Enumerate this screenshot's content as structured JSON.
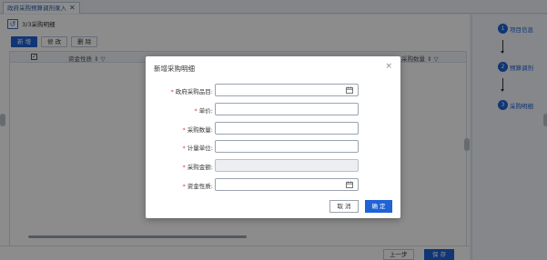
{
  "tabstrip": {
    "tab_label": "政府采购预算调剂录入",
    "tab_close": "✕"
  },
  "breadcrumb": {
    "back_icon": "↺",
    "text": "3/3采购明细"
  },
  "toolbar": {
    "add_label": "新 增",
    "edit_label": "修 改",
    "delete_label": "删 除"
  },
  "grid": {
    "columns": [
      {
        "label": "资金性质 ⇕ ▽"
      },
      {
        "label": "采购数量 ⇕ ▽"
      }
    ]
  },
  "footer": {
    "prev_label": "上一步",
    "save_label": "保 存"
  },
  "steps": [
    {
      "number": "1",
      "label": "项目信息"
    },
    {
      "number": "2",
      "label": "预算调剂"
    },
    {
      "number": "3",
      "label": "采购明细"
    }
  ],
  "modal": {
    "title": "新增采购明细",
    "close": "×",
    "fields": [
      {
        "label": "政府采购品目:",
        "required": true,
        "value": "",
        "has_picker": true,
        "disabled": false
      },
      {
        "label": "单价:",
        "required": true,
        "value": "",
        "has_picker": false,
        "disabled": false
      },
      {
        "label": "采购数量:",
        "required": true,
        "value": "",
        "has_picker": false,
        "disabled": false
      },
      {
        "label": "计量单位:",
        "required": true,
        "value": "",
        "has_picker": false,
        "disabled": false
      },
      {
        "label": "采购金额:",
        "required": true,
        "value": "",
        "has_picker": false,
        "disabled": true
      },
      {
        "label": "资金性质:",
        "required": true,
        "value": "",
        "has_picker": true,
        "disabled": false
      }
    ],
    "required_mark": "*",
    "cancel_label": "取 消",
    "ok_label": "确 定"
  },
  "colors": {
    "accent": "#1f63d6",
    "required": "#e53935",
    "overlay": "rgba(0,0,0,0.45)"
  }
}
